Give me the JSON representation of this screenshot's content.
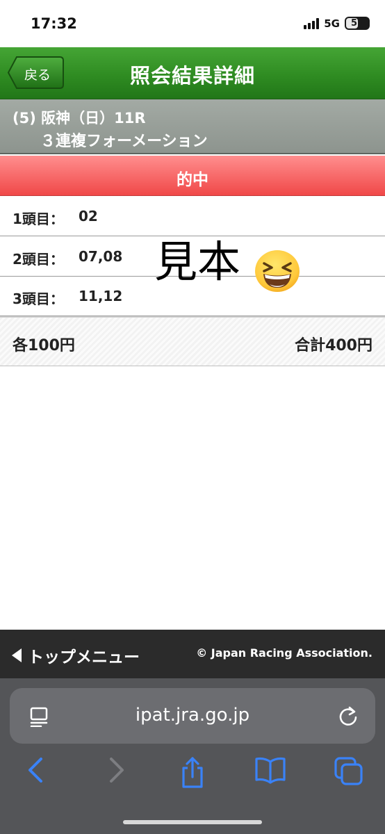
{
  "status_bar": {
    "time": "17:32",
    "network": "5G",
    "battery": "52",
    "battery_fraction": 0.52
  },
  "header": {
    "back_label": "戻る",
    "title": "照会結果詳細"
  },
  "race": {
    "line1": "(5) 阪神（日）11R",
    "line2": "３連複フォーメーション"
  },
  "result": {
    "label": "的中"
  },
  "rows": [
    {
      "label": "1頭目：",
      "value": "02"
    },
    {
      "label": "2頭目：",
      "value": "07,08"
    },
    {
      "label": "3頭目：",
      "value": "11,12"
    }
  ],
  "overlay": {
    "text": "見本",
    "emoji_icon": "grinning-squinting-face-icon"
  },
  "total": {
    "each": "各100円",
    "sum": "合計400円"
  },
  "menu": {
    "top_menu_label": "トップメニュー",
    "copyright": "© Japan Racing Association."
  },
  "browser": {
    "url": "ipat.jra.go.jp",
    "accent_color": "#3a82f7"
  },
  "colors": {
    "header_green": "#2f8c22",
    "hit_red": "#f04848",
    "race_gray": "#98a099"
  }
}
